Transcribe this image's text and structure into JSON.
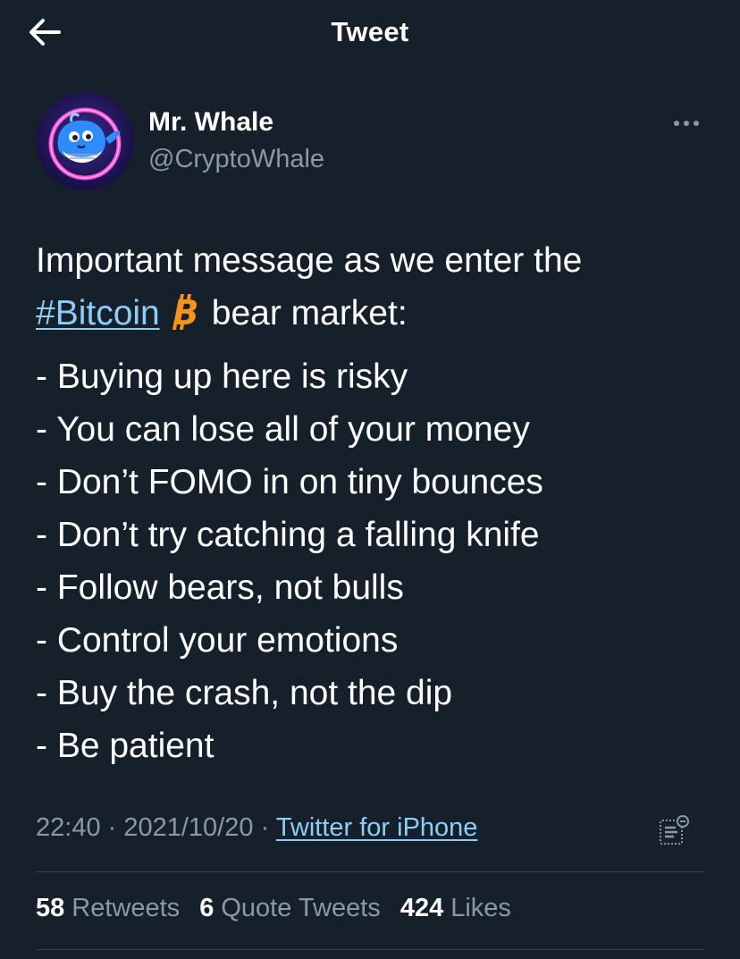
{
  "header": {
    "title": "Tweet"
  },
  "author": {
    "display_name": "Mr. Whale",
    "handle": "@CryptoWhale"
  },
  "tweet": {
    "intro_line_1": "Important message as we enter the",
    "hashtag": "#Bitcoin",
    "intro_line_2_rest": "bear market:",
    "list": [
      "- Buying up here is risky",
      "- You can lose all of your money",
      "- Don’t FOMO in on tiny bounces",
      "- Don’t try catching a falling knife",
      "- Follow bears, not bulls",
      "- Control your emotions",
      "- Buy the crash, not the dip",
      "- Be patient"
    ]
  },
  "meta": {
    "time": "22:40",
    "separator": " · ",
    "date": "2021/10/20",
    "source": "Twitter for iPhone"
  },
  "stats": {
    "retweets_count": "58",
    "retweets_label": "Retweets",
    "quotes_count": "6",
    "quotes_label": "Quote Tweets",
    "likes_count": "424",
    "likes_label": "Likes"
  },
  "colors": {
    "background": "#15202b",
    "link": "#8ecdf8",
    "secondary_text": "#8b98a5",
    "bitcoin_orange": "#f7931a"
  },
  "icons": {
    "back": "back-arrow-icon",
    "more": "more-dots-icon",
    "bitcoin": "bitcoin-icon",
    "analytics": "tweet-analytics-icon"
  }
}
